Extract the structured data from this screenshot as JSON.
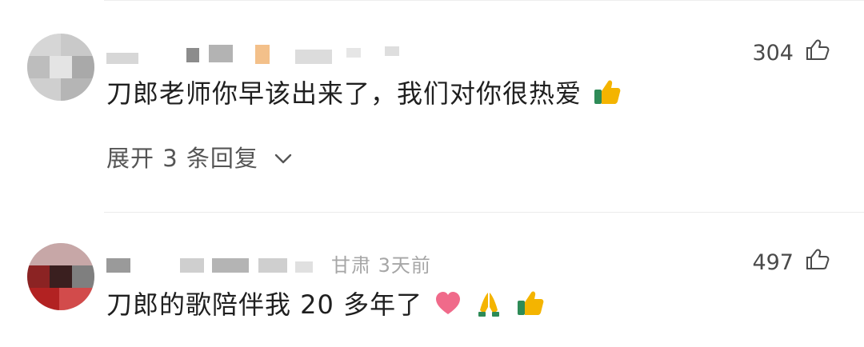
{
  "comments": [
    {
      "text": "刀郎老师你早该出来了，我们对你很热爱",
      "emoji": [
        "thumbs-up"
      ],
      "like_count": "304",
      "replies_label": "展开 3 条回复"
    },
    {
      "location_time": "甘肃 3天前",
      "text": "刀郎的歌陪伴我 20 多年了",
      "emoji": [
        "heart",
        "praying-hands",
        "thumbs-up"
      ],
      "like_count": "497"
    }
  ],
  "icons": {
    "like": "thumbs-up-outline-icon",
    "expand": "chevron-down-icon"
  },
  "colors": {
    "text": "#1f1f1f",
    "secondary": "#a6a6a6",
    "reply_link": "#555555",
    "heart": "#f06a8a",
    "thumb": "#f4b400"
  }
}
